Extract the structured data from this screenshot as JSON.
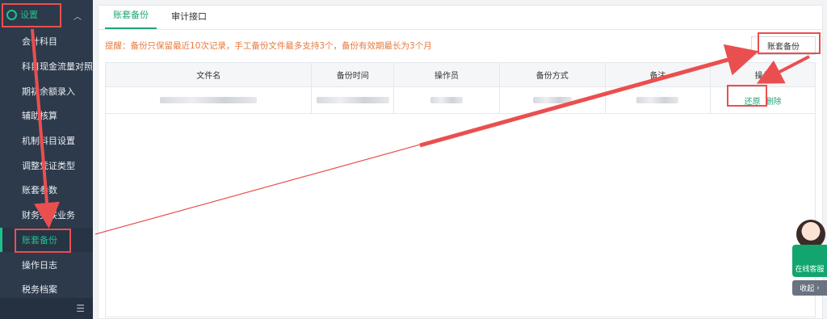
{
  "sidebar": {
    "header": {
      "label": "设置"
    },
    "items": [
      {
        "label": "会计科目"
      },
      {
        "label": "科目现金流量对照"
      },
      {
        "label": "期初余额录入"
      },
      {
        "label": "辅助核算"
      },
      {
        "label": "机制科目设置"
      },
      {
        "label": "调整凭证类型"
      },
      {
        "label": "账套参数"
      },
      {
        "label": "财务关联业务"
      },
      {
        "label": "账套备份",
        "active": true
      },
      {
        "label": "操作日志"
      },
      {
        "label": "税务档案"
      }
    ]
  },
  "tabs": [
    {
      "label": "账套备份",
      "active": true
    },
    {
      "label": "审计接口"
    }
  ],
  "reminder": "提醒：备份只保留最近10次记录，手工备份文件最多支持3个，备份有效期最长为3个月",
  "backup_button": "账套备份",
  "table": {
    "headers": [
      "文件名",
      "备份时间",
      "操作员",
      "备份方式",
      "备注",
      "操作"
    ],
    "row": {
      "restore": "还原",
      "delete": "删除"
    }
  },
  "customer_service": {
    "label": "在线客服",
    "collapse": "收起"
  },
  "colors": {
    "accent": "#21a675",
    "sidebar_bg": "#2d3a4b",
    "annotation": "#ea4f4f",
    "reminder": "#e8793b"
  }
}
